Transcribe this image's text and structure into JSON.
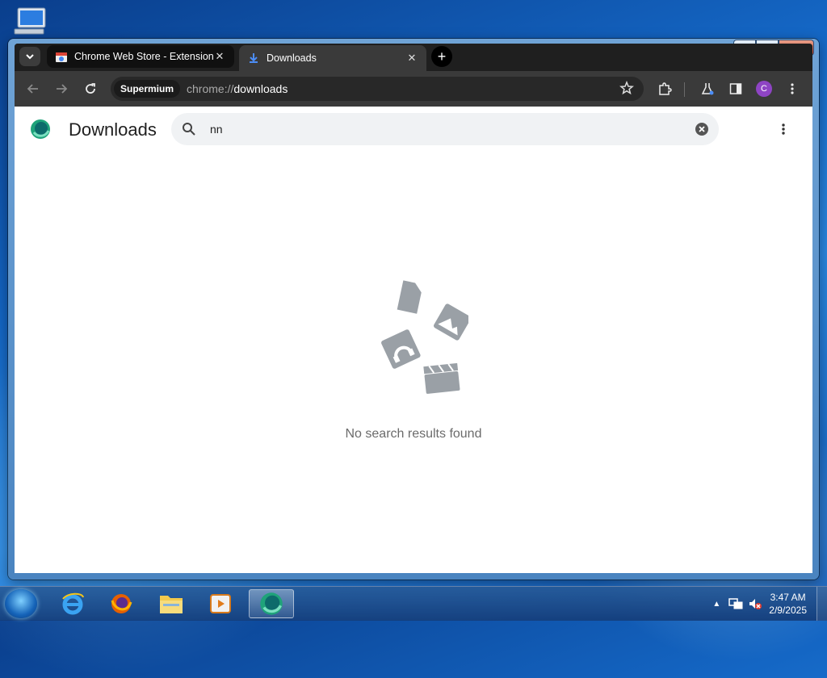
{
  "tabs": [
    {
      "title": "Chrome Web Store - Extensions",
      "active": false
    },
    {
      "title": "Downloads",
      "active": true
    }
  ],
  "toolbar": {
    "site_chip": "Supermium",
    "url_scheme": "chrome://",
    "url_host": "downloads",
    "profile_initial": "C"
  },
  "page": {
    "title": "Downloads",
    "search_query": "nn",
    "empty_message": "No search results found"
  },
  "taskbar": {
    "time": "3:47 AM",
    "date": "2/9/2025"
  },
  "colors": {
    "accent": "#1a73e8",
    "profile": "#8e44c4",
    "empty_art": "#9aa0a6"
  }
}
